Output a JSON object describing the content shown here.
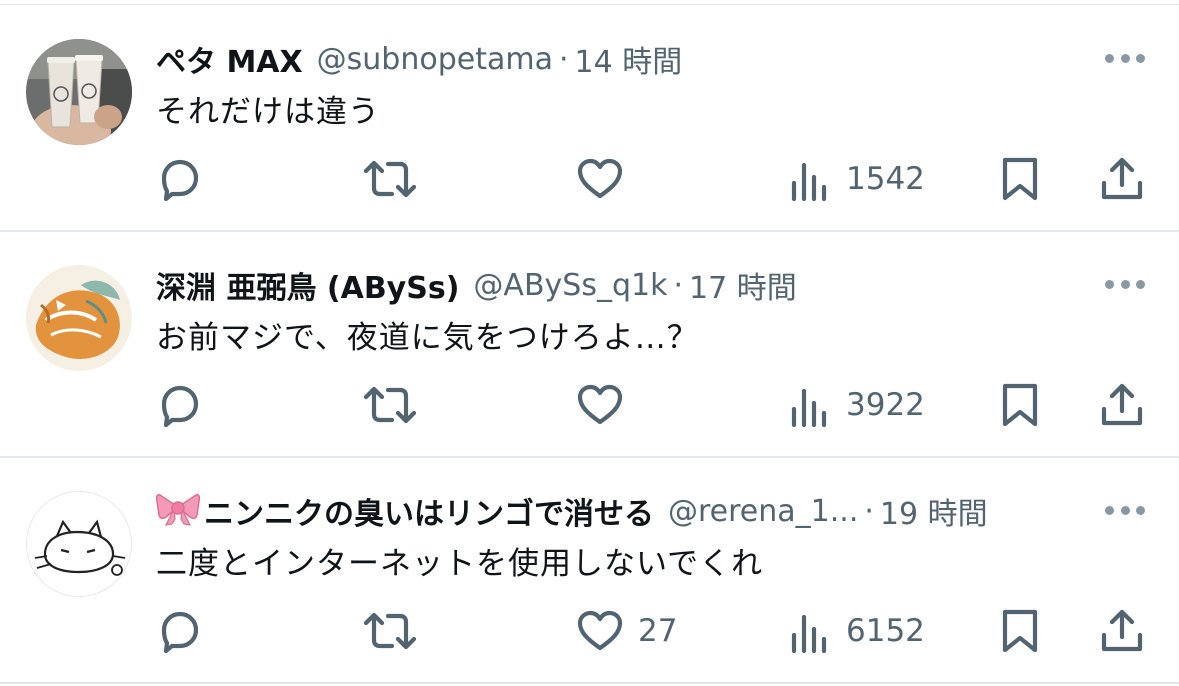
{
  "colors": {
    "text": "#0f1419",
    "secondary": "#536471",
    "icon": "#536471",
    "divider": "#e4e7ea"
  },
  "tweets": [
    {
      "name": "ペタ MAX",
      "handle": "@subnopetama",
      "separator": "·",
      "time": "14 時間",
      "text": "それだけは違う",
      "avatar": "avatar-photo-cups",
      "counts": {
        "reply": "",
        "retweet": "",
        "like": "",
        "views": "1542"
      }
    },
    {
      "name": "深淵 亜弼鳥 (ABySs)",
      "handle": "@ABySs_q1k",
      "separator": "·",
      "time": "17 時間",
      "text": "お前マジで、夜道に気をつけろよ…？",
      "avatar": "avatar-illustration-fox",
      "counts": {
        "reply": "",
        "retweet": "",
        "like": "",
        "views": "3922"
      }
    },
    {
      "name": "ニンニクの臭いはリンゴで消せる",
      "name_emoji": "ribbon-emoji",
      "handle": "@rerena_1...",
      "separator": "·",
      "time": "19 時間",
      "text": "二度とインターネットを使用しないでくれ",
      "avatar": "avatar-sketch-cat",
      "counts": {
        "reply": "",
        "retweet": "",
        "like": "27",
        "views": "6152"
      }
    }
  ]
}
